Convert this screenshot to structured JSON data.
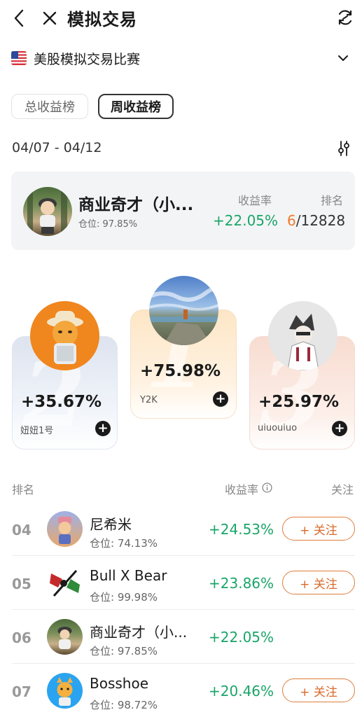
{
  "header": {
    "title": "模拟交易",
    "back_icon": "chevron-left-icon",
    "close_icon": "close-icon",
    "refresh_icon": "refresh-icon"
  },
  "competition": {
    "name": "美股模拟交易比赛",
    "flag_icon": "us-flag-icon",
    "dropdown_icon": "chevron-down-icon"
  },
  "tabs": [
    {
      "label": "总收益榜",
      "active": false
    },
    {
      "label": "周收益榜",
      "active": true
    }
  ],
  "date_range": "04/07 - 04/12",
  "filter_icon": "sliders-icon",
  "my_rank": {
    "name": "商业奇才（小...",
    "position": "仓位: 97.85%",
    "return_label": "收益率",
    "return_value": "+22.05%",
    "rank_label": "排名",
    "rank_value": "6",
    "rank_total": "/12828"
  },
  "podium": [
    {
      "place": "2",
      "return": "+35.67%",
      "name": "妞妞1号",
      "follow_icon": "plus-icon"
    },
    {
      "place": "1",
      "return": "+75.98%",
      "name": "Y2K",
      "follow_icon": "plus-icon"
    },
    {
      "place": "3",
      "return": "+25.97%",
      "name": "uiuouiuo",
      "follow_icon": "plus-icon"
    }
  ],
  "list_header": {
    "rank": "排名",
    "return": "收益率",
    "info_icon": "info-icon",
    "follow": "关注"
  },
  "rows": [
    {
      "rank": "04",
      "name": "尼希米",
      "position": "仓位:  74.13%",
      "return": "+24.53%",
      "follow": "+ 关注"
    },
    {
      "rank": "05",
      "name": "Bull X Bear",
      "position": "仓位:  99.98%",
      "return": "+23.86%",
      "follow": "+ 关注"
    },
    {
      "rank": "06",
      "name": "商业奇才（小...",
      "position": "仓位:  97.85%",
      "return": "+22.05%",
      "follow": ""
    },
    {
      "rank": "07",
      "name": "Bosshoe",
      "position": "仓位:  98.72%",
      "return": "+20.46%",
      "follow": "+ 关注"
    }
  ],
  "colors": {
    "positive": "#1aa568",
    "rank_highlight": "#ef7a2e",
    "follow_border": "#e07d3c"
  }
}
